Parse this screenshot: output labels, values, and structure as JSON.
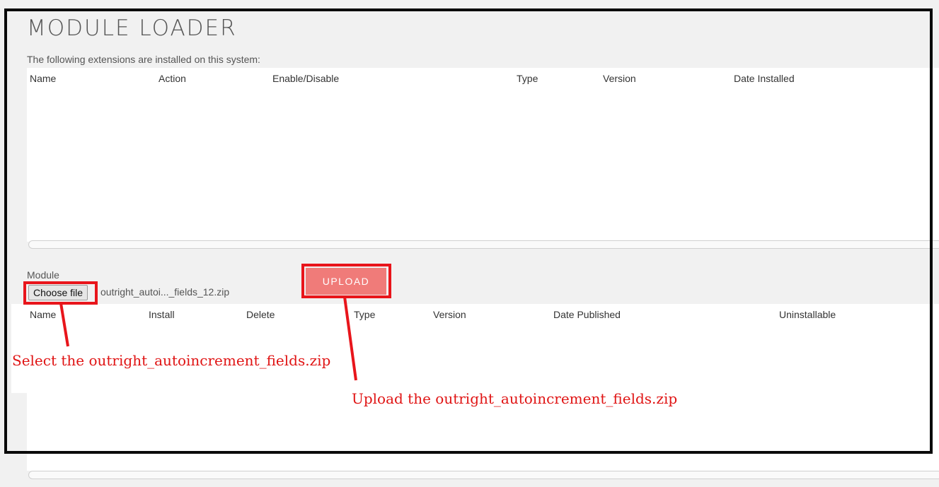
{
  "page": {
    "title": "MODULE LOADER",
    "installed_caption": "The following extensions are installed on this system:"
  },
  "installed_table": {
    "headers": [
      "Name",
      "Action",
      "Enable/Disable",
      "Type",
      "Version",
      "Date Installed"
    ]
  },
  "upload": {
    "module_label": "Module",
    "choose_file_label": "Choose file",
    "chosen_file": "outright_autoi..._fields_12.zip",
    "upload_label": "UPLOAD"
  },
  "package_table": {
    "headers": [
      "Name",
      "Install",
      "Delete",
      "Type",
      "Version",
      "Date Published",
      "Uninstallable"
    ]
  },
  "annotations": {
    "select": "Select the outright_autoincrement_fields.zip",
    "upload": "Upload the outright_autoincrement_fields.zip",
    "color": "#e8151b"
  }
}
